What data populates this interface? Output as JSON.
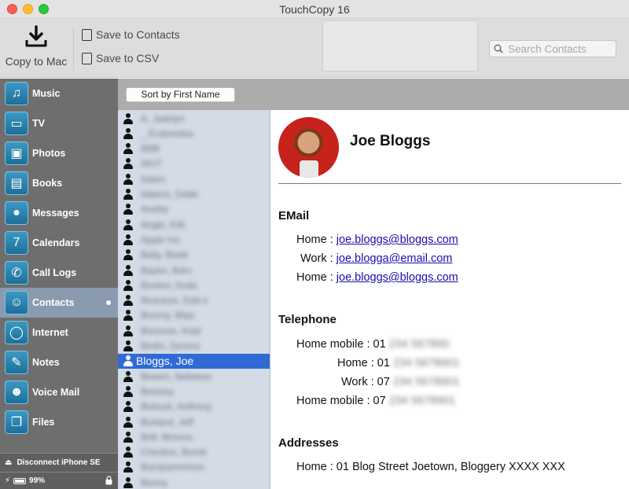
{
  "window": {
    "title": "TouchCopy 16"
  },
  "toolbar": {
    "copy_label": "Copy to Mac",
    "save_contacts_label": "Save to Contacts",
    "save_csv_label": "Save to CSV",
    "search_placeholder": "Search Contacts"
  },
  "sidebar": {
    "items": [
      {
        "label": "Music",
        "icon": "music-icon"
      },
      {
        "label": "TV",
        "icon": "tv-icon"
      },
      {
        "label": "Photos",
        "icon": "photos-icon"
      },
      {
        "label": "Books",
        "icon": "books-icon"
      },
      {
        "label": "Messages",
        "icon": "messages-icon"
      },
      {
        "label": "Calendars",
        "icon": "calendar-icon"
      },
      {
        "label": "Call Logs",
        "icon": "phone-icon"
      },
      {
        "label": "Contacts",
        "icon": "contacts-icon"
      },
      {
        "label": "Internet",
        "icon": "internet-icon"
      },
      {
        "label": "Notes",
        "icon": "notes-icon"
      },
      {
        "label": "Voice Mail",
        "icon": "voicemail-icon"
      },
      {
        "label": "Files",
        "icon": "files-icon"
      }
    ],
    "active": "Contacts",
    "disconnect_label": "Disconnect iPhone SE",
    "battery": "99%"
  },
  "sort": {
    "label": "Sort by First Name"
  },
  "contacts": {
    "names": [
      "A, Jadelyn",
      "_ Ecdsmdea",
      "BBB",
      "AKIT",
      "Adam",
      "Adams, Debb",
      "Anetta",
      "Angle, Killi",
      "Apple Inc.",
      "Bally, Bedd",
      "Baylor, Bdrs",
      "Beebor, Ande",
      "Beaneze, Edd e",
      "Brenny, Bbja",
      "Breonne, Kidd",
      "Bedin, Demns",
      "Bloggs, Joe",
      "Bewen, Nebeeec",
      "Bewsey",
      "Bubock, Anthony",
      "Burland, Jeff",
      "Brill, Moress",
      "Chenton, Bomb",
      "Bompammmon",
      "Boney"
    ],
    "selected": "Bloggs, Joe"
  },
  "detail": {
    "name": "Joe Bloggs",
    "email_heading": "EMail",
    "emails": [
      {
        "label": "Home :",
        "value": "joe.bloggs@bloggs.com"
      },
      {
        "label": "Work :",
        "value": "joe.blogga@email.com"
      },
      {
        "label": "Home :",
        "value": "joe.bloggs@bloggs.com"
      }
    ],
    "phone_heading": "Telephone",
    "phones": [
      {
        "label": "Home mobile :",
        "prefix": "01",
        "rest": "234 567890"
      },
      {
        "label": "Home :",
        "prefix": "01",
        "rest": "234 5678901"
      },
      {
        "label": "Work :",
        "prefix": "07",
        "rest": "234 5678901"
      },
      {
        "label": "Home mobile :",
        "prefix": "07",
        "rest": "234 5678901"
      }
    ],
    "address_heading": "Addresses",
    "addresses": [
      {
        "label": "Home :",
        "value": "01 Blog Street Joetown, Bloggery XXXX XXX"
      }
    ]
  }
}
